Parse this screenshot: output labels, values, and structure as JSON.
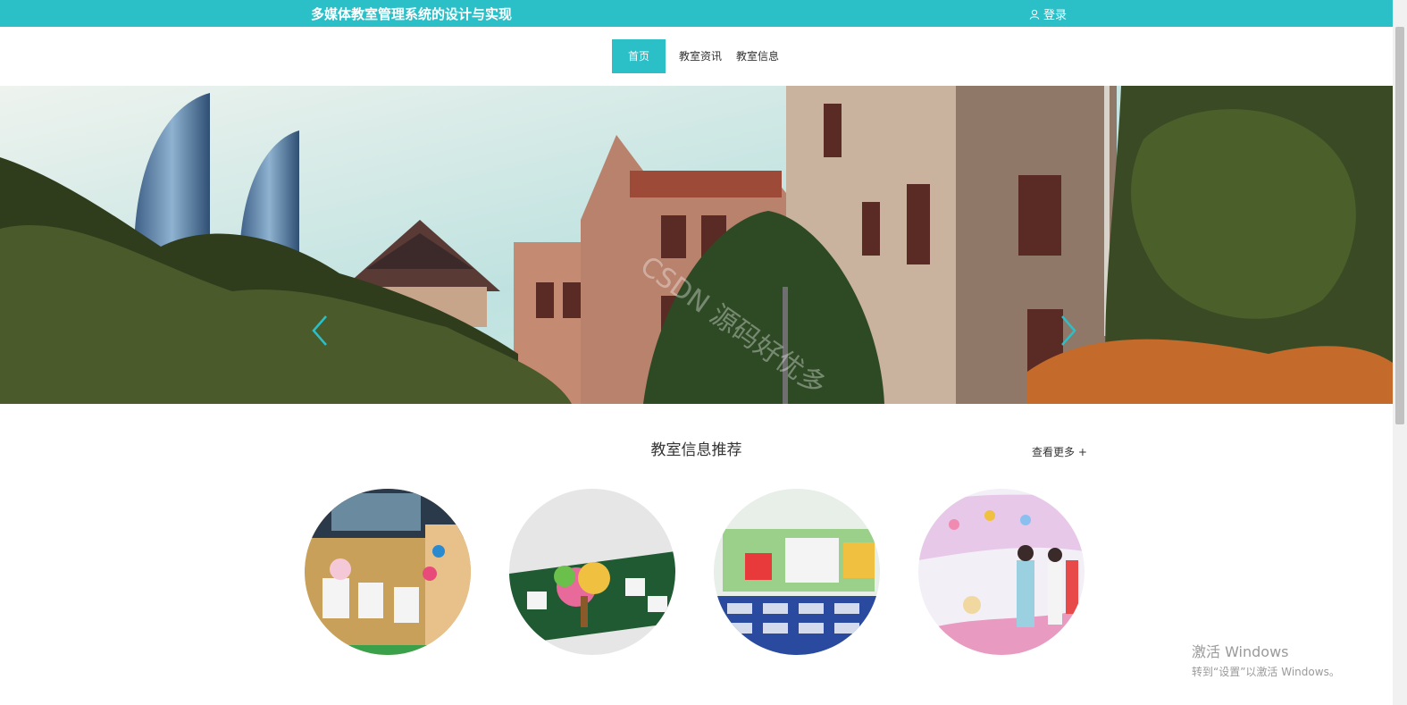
{
  "header": {
    "title": "多媒体教室管理系统的设计与实现",
    "login_label": "登录",
    "accent_color": "#2bbfc8"
  },
  "nav": {
    "items": [
      {
        "label": "首页",
        "active": true
      },
      {
        "label": "教室资讯",
        "active": false
      },
      {
        "label": "教室信息",
        "active": false
      }
    ]
  },
  "banner": {
    "watermark": "CSDN 源码好优多",
    "prev_icon": "chevron-left-icon",
    "next_icon": "chevron-right-icon"
  },
  "section": {
    "title": "教室信息推荐",
    "more_label": "查看更多 +"
  },
  "system": {
    "activate_title": "激活 Windows",
    "activate_sub": "转到“设置”以激活 Windows。"
  }
}
